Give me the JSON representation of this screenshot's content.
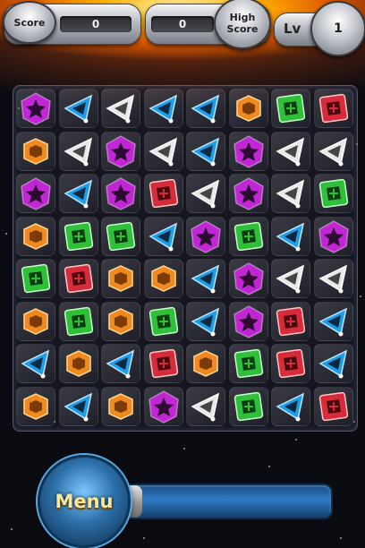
{
  "hud": {
    "score_label": "Score",
    "score_value": "0",
    "high_score_label_line1": "High",
    "high_score_label_line2": "Score",
    "high_score_value": "0",
    "level_label": "Lv",
    "level_value": "1"
  },
  "board": {
    "rows": 8,
    "cols": 8,
    "grid": [
      [
        "purple",
        "blue",
        "white",
        "blue",
        "blue",
        "orange",
        "green",
        "red"
      ],
      [
        "orange",
        "white",
        "purple",
        "white",
        "blue",
        "purple",
        "white",
        "white"
      ],
      [
        "purple",
        "blue",
        "purple",
        "red",
        "white",
        "purple",
        "white",
        "green"
      ],
      [
        "orange",
        "green",
        "green",
        "blue",
        "purple",
        "green",
        "blue",
        "purple"
      ],
      [
        "green",
        "red",
        "orange",
        "orange",
        "blue",
        "purple",
        "white",
        "white"
      ],
      [
        "orange",
        "green",
        "orange",
        "green",
        "blue",
        "purple",
        "red",
        "blue"
      ],
      [
        "blue",
        "orange",
        "blue",
        "red",
        "orange",
        "green",
        "red",
        "blue"
      ],
      [
        "orange",
        "blue",
        "orange",
        "purple",
        "white",
        "green",
        "blue",
        "red"
      ]
    ],
    "gem_colors": {
      "purple": "#c026d3",
      "blue": "#1e9ee8",
      "white": "#e8e8e8",
      "orange": "#f08a1e",
      "green": "#2fbf3a",
      "red": "#d62b3a"
    }
  },
  "menu": {
    "label": "Menu",
    "progress": 0.12
  }
}
